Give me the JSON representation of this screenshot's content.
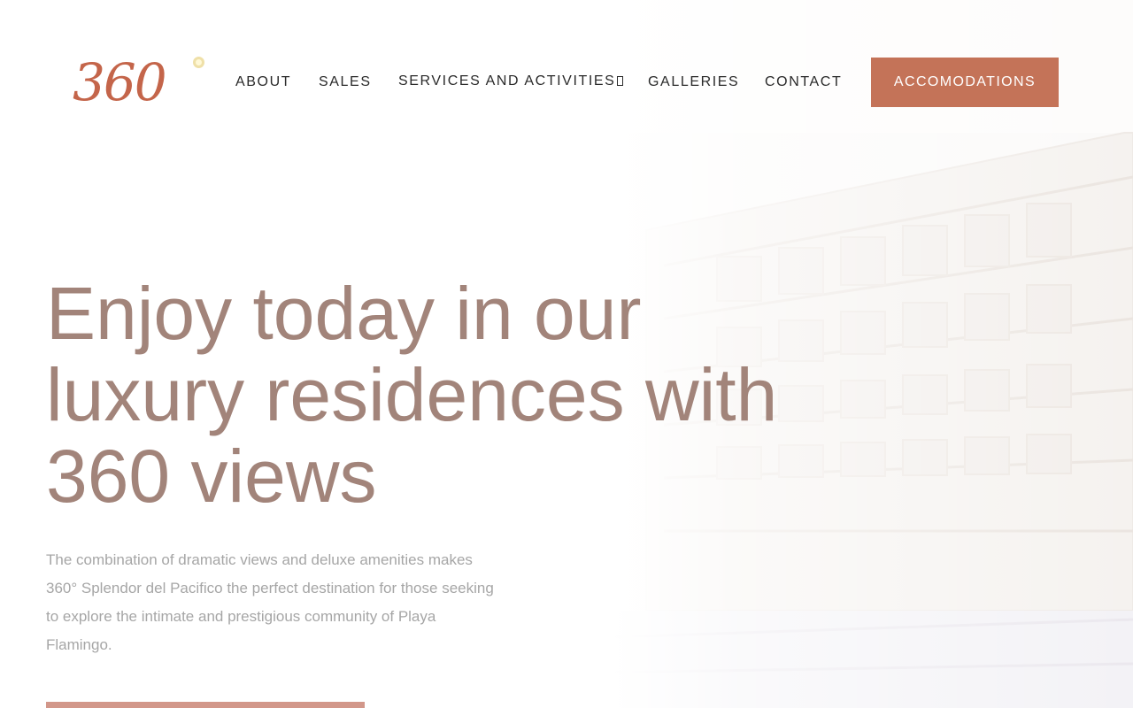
{
  "logo": {
    "text": "360"
  },
  "nav": {
    "items": [
      {
        "label": "ABOUT"
      },
      {
        "label": "SALES"
      },
      {
        "label": "SERVICES AND ACTIVITIES"
      },
      {
        "label": "GALLERIES"
      },
      {
        "label": "CONTACT"
      }
    ],
    "cta_label": "ACCOMODATIONS"
  },
  "hero": {
    "title_line1": "Enjoy today in our",
    "title_line2": "luxury residences with",
    "title_line3": "360 views",
    "description": "The combination of dramatic views and deluxe amenities makes 360° Splendor del Pacifico the perfect destination for those seeking to explore the intimate and prestigious community of Playa Flamingo."
  },
  "colors": {
    "accent": "#c47358",
    "title": "#a2847a",
    "body_text": "#a6a6a6",
    "logo": "#c4654a"
  },
  "icons": {
    "services_dropdown": "chevron-down-icon"
  }
}
